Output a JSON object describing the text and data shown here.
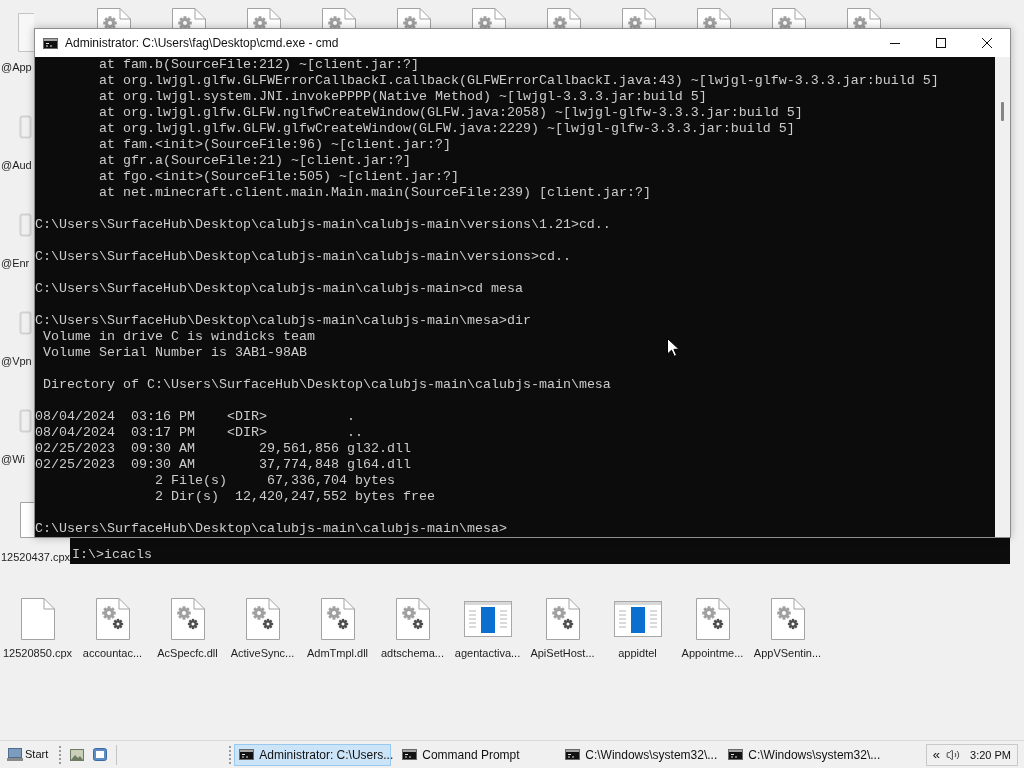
{
  "desktop": {
    "top_row": [
      {
        "kind": "gear_file"
      },
      {
        "kind": "gear_file"
      },
      {
        "kind": "gear_file"
      },
      {
        "kind": "gear_file"
      },
      {
        "kind": "gear_file"
      },
      {
        "kind": "gear_file"
      },
      {
        "kind": "gear_file"
      },
      {
        "kind": "gear_file"
      },
      {
        "kind": "gear_file"
      },
      {
        "kind": "gear_file"
      },
      {
        "kind": "gear_file"
      }
    ],
    "left_column": [
      {
        "label": "@App",
        "kind": "window"
      },
      {
        "label": "@Aud",
        "kind": "faded"
      },
      {
        "label": "@Enr",
        "kind": "faded"
      },
      {
        "label": "@Vpn",
        "kind": "faded"
      },
      {
        "label": "@Wi",
        "kind": "faded"
      },
      {
        "label": "12520437.cpx",
        "kind": "blank_file"
      }
    ],
    "bottom_row": [
      {
        "label": "12520850.cpx",
        "kind": "blank_file"
      },
      {
        "label": "accountac...",
        "kind": "gear_file"
      },
      {
        "label": "AcSpecfc.dll",
        "kind": "gear_file"
      },
      {
        "label": "ActiveSync...",
        "kind": "gear_file"
      },
      {
        "label": "AdmTmpl.dll",
        "kind": "gear_file"
      },
      {
        "label": "adtschema...",
        "kind": "gear_file"
      },
      {
        "label": "agentactiva...",
        "kind": "app_window"
      },
      {
        "label": "ApiSetHost...",
        "kind": "gear_file"
      },
      {
        "label": "appidtel",
        "kind": "app_window"
      },
      {
        "label": "Appointme...",
        "kind": "gear_file"
      },
      {
        "label": "AppVSentin...",
        "kind": "gear_file"
      }
    ]
  },
  "background_console": {
    "line": "I:\\>icacls"
  },
  "console_window": {
    "title": "Administrator: C:\\Users\\fag\\Desktop\\cmd.exe - cmd",
    "blocks": [
      [
        {
          "kind": "trace",
          "text": "at fam.b(SourceFile:212) ~[client.jar:?]"
        },
        {
          "kind": "trace",
          "text": "at org.lwjgl.glfw.GLFWErrorCallbackI.callback(GLFWErrorCallbackI.java:43) ~[lwjgl-glfw-3.3.3.jar:build 5]"
        },
        {
          "kind": "trace",
          "text": "at org.lwjgl.system.JNI.invokePPPP(Native Method) ~[lwjgl-3.3.3.jar:build 5]"
        },
        {
          "kind": "trace",
          "text": "at org.lwjgl.glfw.GLFW.nglfwCreateWindow(GLFW.java:2058) ~[lwjgl-glfw-3.3.3.jar:build 5]"
        },
        {
          "kind": "trace",
          "text": "at org.lwjgl.glfw.GLFW.glfwCreateWindow(GLFW.java:2229) ~[lwjgl-glfw-3.3.3.jar:build 5]"
        },
        {
          "kind": "trace",
          "text": "at fam.<init>(SourceFile:96) ~[client.jar:?]"
        },
        {
          "kind": "trace",
          "text": "at gfr.a(SourceFile:21) ~[client.jar:?]"
        },
        {
          "kind": "trace",
          "text": "at fgo.<init>(SourceFile:505) ~[client.jar:?]"
        },
        {
          "kind": "trace",
          "text": "at net.minecraft.client.main.Main.main(SourceFile:239) [client.jar:?]"
        }
      ],
      [
        {
          "kind": "command",
          "text": "C:\\Users\\SurfaceHub\\Desktop\\calubjs-main\\calubjs-main\\versions\\1.21>cd.."
        }
      ],
      [
        {
          "kind": "command",
          "text": "C:\\Users\\SurfaceHub\\Desktop\\calubjs-main\\calubjs-main\\versions>cd.."
        }
      ],
      [
        {
          "kind": "command",
          "text": "C:\\Users\\SurfaceHub\\Desktop\\calubjs-main\\calubjs-main>cd mesa"
        }
      ],
      [
        {
          "kind": "command",
          "text": "C:\\Users\\SurfaceHub\\Desktop\\calubjs-main\\calubjs-main\\mesa>dir"
        },
        {
          "kind": "output",
          "text": "Volume in drive C is windicks team"
        },
        {
          "kind": "output",
          "text": "Volume Serial Number is 3AB1-98AB"
        }
      ],
      [
        {
          "kind": "output",
          "text": "Directory of C:\\Users\\SurfaceHub\\Desktop\\calubjs-main\\calubjs-main\\mesa"
        }
      ],
      [
        {
          "kind": "file",
          "text": "08/04/2024  03:16 PM    <DIR>          ."
        },
        {
          "kind": "file",
          "text": "08/04/2024  03:17 PM    <DIR>          .."
        },
        {
          "kind": "file",
          "text": "02/25/2023  09:30 AM        29,561,856 gl32.dll"
        },
        {
          "kind": "file",
          "text": "02/25/2023  09:30 AM        37,774,848 gl64.dll"
        },
        {
          "kind": "summary",
          "text": "2 File(s)     67,336,704 bytes"
        },
        {
          "kind": "summary",
          "text": "2 Dir(s)  12,420,247,552 bytes free"
        }
      ],
      [
        {
          "kind": "command",
          "text": "C:\\Users\\SurfaceHub\\Desktop\\calubjs-main\\calubjs-main\\mesa>"
        }
      ]
    ]
  },
  "taskbar": {
    "start": "Start",
    "tasks": [
      {
        "label": "Administrator: C:\\Users...",
        "selected": true
      },
      {
        "label": "Command Prompt",
        "selected": false
      },
      {
        "label": "C:\\Windows\\system32\\...",
        "selected": false
      },
      {
        "label": "C:\\Windows\\system32\\...",
        "selected": false
      }
    ],
    "tray_toggle": "«",
    "clock": "3:20 PM"
  }
}
